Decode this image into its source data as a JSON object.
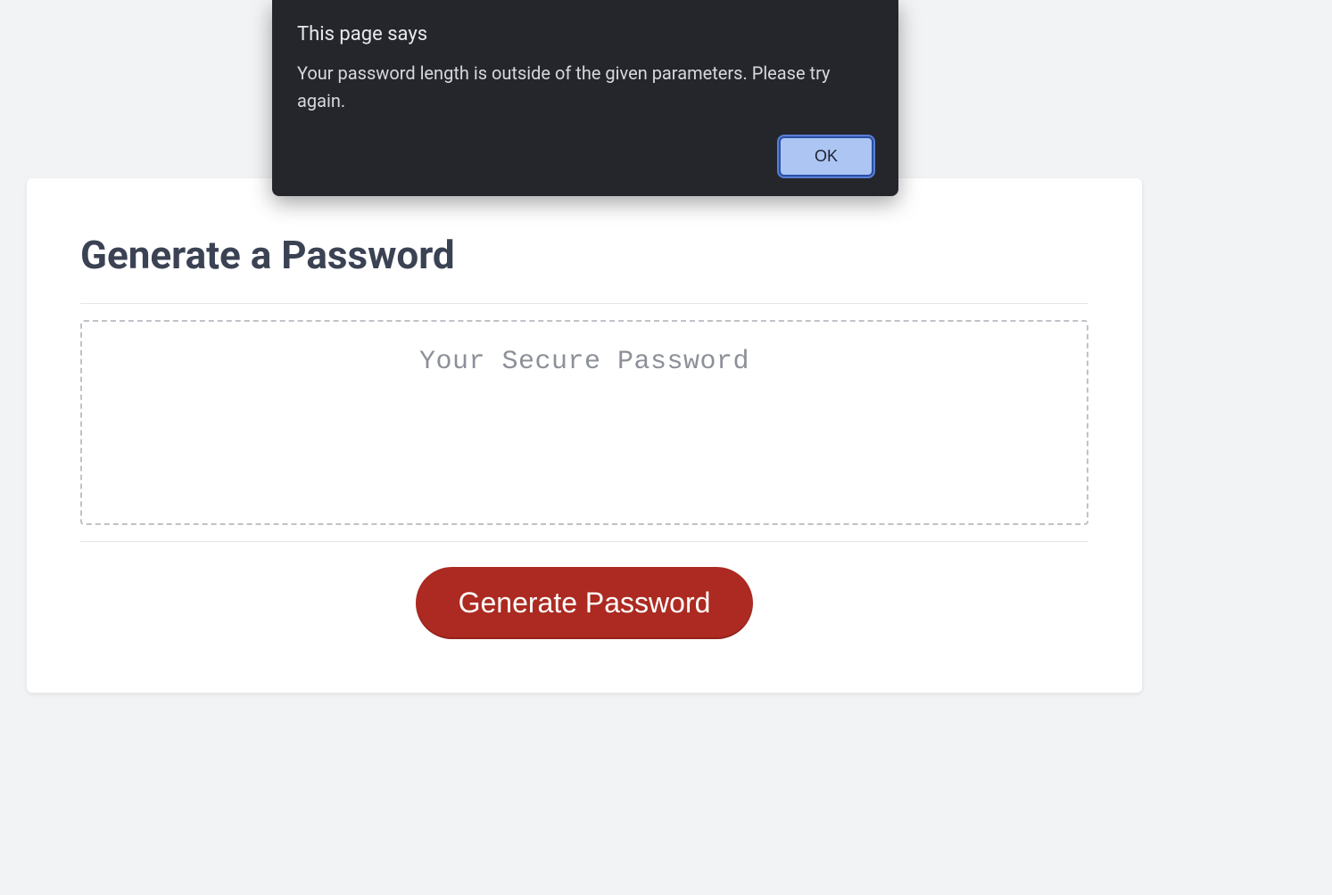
{
  "alert": {
    "title": "This page says",
    "message": "Your password length is outside of the given parameters. Please try again.",
    "ok_label": "OK"
  },
  "card": {
    "title": "Generate a Password",
    "password_placeholder": "Your Secure Password",
    "generate_label": "Generate Password"
  }
}
